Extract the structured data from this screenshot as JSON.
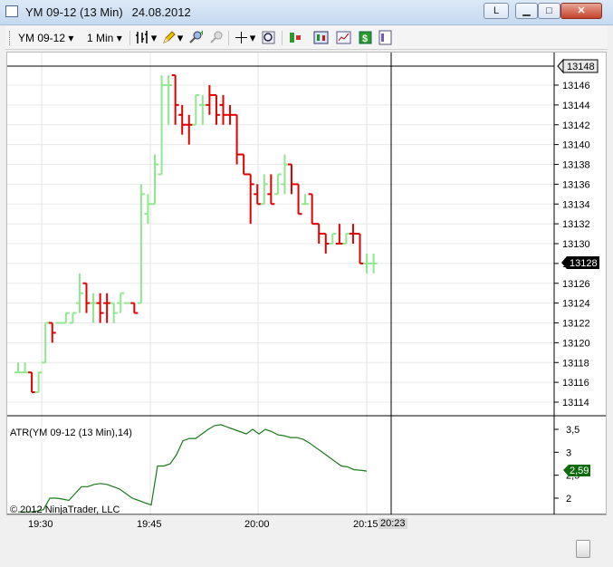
{
  "window": {
    "title": "YM 09-12 (13 Min)",
    "date": "24.08.2012",
    "buttons": {
      "user": "L",
      "minimize": "▁",
      "maximize": "□",
      "close": "✕"
    }
  },
  "toolbar": {
    "instrument": "YM 09-12",
    "interval": "1 Min",
    "icons": [
      "bar-style-icon",
      "pencil-draw-icon",
      "zoom-in-icon",
      "zoom-out-icon",
      "crosshair-icon",
      "magnify-icon",
      "strategies-icon",
      "indicators-icon",
      "chart-icon",
      "money-icon",
      "properties-icon"
    ]
  },
  "price_panel": {
    "y_ticks": [
      "13146",
      "13144",
      "13142",
      "13140",
      "13138",
      "13136",
      "13134",
      "13132",
      "13130",
      "13128",
      "13126",
      "13124",
      "13122",
      "13120",
      "13118",
      "13116",
      "13114"
    ],
    "crosshair_price": "13148",
    "last_price": "13128"
  },
  "indicator_panel": {
    "label": "ATR(YM 09-12 (13 Min),14)",
    "y_ticks": [
      "3,5",
      "3",
      "2,5",
      "2"
    ],
    "current_value": "2,59"
  },
  "time_axis": {
    "labels": [
      "19:30",
      "19:45",
      "20:00",
      "20:15"
    ],
    "crosshair_time": "20:23"
  },
  "copyright": "© 2012 NinjaTrader, LLC",
  "colors": {
    "up": "#8ee88e",
    "down": "#e00000",
    "atr": "#1a7a1a",
    "crosshair": "#000000"
  },
  "chart_data": [
    {
      "type": "ohlc",
      "bars": [
        {
          "o": 13117,
          "h": 13118,
          "l": 13117,
          "c": 13117,
          "dir": "up"
        },
        {
          "o": 13117,
          "h": 13118,
          "l": 13117,
          "c": 13117,
          "dir": "up"
        },
        {
          "o": 13117,
          "h": 13117,
          "l": 13115,
          "c": 13115,
          "dir": "down"
        },
        {
          "o": 13115,
          "h": 13117,
          "l": 13115,
          "c": 13117,
          "dir": "up"
        },
        {
          "o": 13118,
          "h": 13122,
          "l": 13118,
          "c": 13122,
          "dir": "up"
        },
        {
          "o": 13122,
          "h": 13122,
          "l": 13120,
          "c": 13121,
          "dir": "down"
        },
        {
          "o": 13122,
          "h": 13122,
          "l": 13122,
          "c": 13122,
          "dir": "up"
        },
        {
          "o": 13122,
          "h": 13123,
          "l": 13122,
          "c": 13123,
          "dir": "up"
        },
        {
          "o": 13122,
          "h": 13123,
          "l": 13122,
          "c": 13123,
          "dir": "up"
        },
        {
          "o": 13124,
          "h": 13127,
          "l": 13123,
          "c": 13125,
          "dir": "up"
        },
        {
          "o": 13126,
          "h": 13126,
          "l": 13123,
          "c": 13124,
          "dir": "down"
        },
        {
          "o": 13124,
          "h": 13125,
          "l": 13122,
          "c": 13124,
          "dir": "up"
        },
        {
          "o": 13124,
          "h": 13125,
          "l": 13122,
          "c": 13123,
          "dir": "down"
        },
        {
          "o": 13124,
          "h": 13125,
          "l": 13122,
          "c": 13124,
          "dir": "down"
        },
        {
          "o": 13124,
          "h": 13124,
          "l": 13122,
          "c": 13123,
          "dir": "up"
        },
        {
          "o": 13124,
          "h": 13125,
          "l": 13123,
          "c": 13125,
          "dir": "up"
        },
        {
          "o": 13124,
          "h": 13124,
          "l": 13124,
          "c": 13124,
          "dir": "up"
        },
        {
          "o": 13124,
          "h": 13124,
          "l": 13123,
          "c": 13123,
          "dir": "down"
        },
        {
          "o": 13124,
          "h": 13136,
          "l": 13124,
          "c": 13135,
          "dir": "up"
        },
        {
          "o": 13133,
          "h": 13135,
          "l": 13132,
          "c": 13134,
          "dir": "up"
        },
        {
          "o": 13134,
          "h": 13139,
          "l": 13134,
          "c": 13138,
          "dir": "up"
        },
        {
          "o": 13137,
          "h": 13147,
          "l": 13137,
          "c": 13146,
          "dir": "up"
        },
        {
          "o": 13146,
          "h": 13147,
          "l": 13142,
          "c": 13146,
          "dir": "up"
        },
        {
          "o": 13147,
          "h": 13147,
          "l": 13142,
          "c": 13144,
          "dir": "down"
        },
        {
          "o": 13143,
          "h": 13144,
          "l": 13141,
          "c": 13142,
          "dir": "down"
        },
        {
          "o": 13142,
          "h": 13143,
          "l": 13140,
          "c": 13142,
          "dir": "down"
        },
        {
          "o": 13142,
          "h": 13145,
          "l": 13142,
          "c": 13145,
          "dir": "up"
        },
        {
          "o": 13144,
          "h": 13145,
          "l": 13142,
          "c": 13144,
          "dir": "up"
        },
        {
          "o": 13144,
          "h": 13146,
          "l": 13143,
          "c": 13145,
          "dir": "down"
        },
        {
          "o": 13145,
          "h": 13145,
          "l": 13142,
          "c": 13143,
          "dir": "down"
        },
        {
          "o": 13144,
          "h": 13145,
          "l": 13142,
          "c": 13143,
          "dir": "down"
        },
        {
          "o": 13143,
          "h": 13144,
          "l": 13142,
          "c": 13143,
          "dir": "down"
        },
        {
          "o": 13143,
          "h": 13143,
          "l": 13138,
          "c": 13139,
          "dir": "down"
        },
        {
          "o": 13139,
          "h": 13139,
          "l": 13137,
          "c": 13137,
          "dir": "down"
        },
        {
          "o": 13137,
          "h": 13137,
          "l": 13132,
          "c": 13136,
          "dir": "down"
        },
        {
          "o": 13135,
          "h": 13136,
          "l": 13134,
          "c": 13134,
          "dir": "down"
        },
        {
          "o": 13134,
          "h": 13137,
          "l": 13134,
          "c": 13136,
          "dir": "up"
        },
        {
          "o": 13135,
          "h": 13137,
          "l": 13134,
          "c": 13134,
          "dir": "down"
        },
        {
          "o": 13135,
          "h": 13137,
          "l": 13135,
          "c": 13137,
          "dir": "up"
        },
        {
          "o": 13136,
          "h": 13139,
          "l": 13135,
          "c": 13138,
          "dir": "up"
        },
        {
          "o": 13138,
          "h": 13138,
          "l": 13135,
          "c": 13136,
          "dir": "down"
        },
        {
          "o": 13136,
          "h": 13136,
          "l": 13133,
          "c": 13133,
          "dir": "down"
        },
        {
          "o": 13134,
          "h": 13135,
          "l": 13134,
          "c": 13134,
          "dir": "up"
        },
        {
          "o": 13135,
          "h": 13135,
          "l": 13132,
          "c": 13132,
          "dir": "down"
        },
        {
          "o": 13132,
          "h": 13132,
          "l": 13130,
          "c": 13131,
          "dir": "down"
        },
        {
          "o": 13131,
          "h": 13131,
          "l": 13129,
          "c": 13130,
          "dir": "down"
        },
        {
          "o": 13130,
          "h": 13131,
          "l": 13130,
          "c": 13131,
          "dir": "up"
        },
        {
          "o": 13130,
          "h": 13132,
          "l": 13130,
          "c": 13130,
          "dir": "down"
        },
        {
          "o": 13130,
          "h": 13131,
          "l": 13130,
          "c": 13131,
          "dir": "up"
        },
        {
          "o": 13131,
          "h": 13132,
          "l": 13130,
          "c": 13131,
          "dir": "down"
        },
        {
          "o": 13131,
          "h": 13131,
          "l": 13128,
          "c": 13128,
          "dir": "down"
        },
        {
          "o": 13128,
          "h": 13129,
          "l": 13127,
          "c": 13128,
          "dir": "up"
        },
        {
          "o": 13128,
          "h": 13129,
          "l": 13127,
          "c": 13128,
          "dir": "up"
        }
      ],
      "ylim": [
        13113,
        13148
      ]
    },
    {
      "type": "line",
      "name": "ATR(YM 09-12 (13 Min),14)",
      "values": [
        1.7,
        1.7,
        1.7,
        1.72,
        1.75,
        2.0,
        2.0,
        1.98,
        1.95,
        2.1,
        2.25,
        2.25,
        2.3,
        2.32,
        2.3,
        2.25,
        2.2,
        2.1,
        2.0,
        1.95,
        1.9,
        1.85,
        2.7,
        2.7,
        2.75,
        2.95,
        3.25,
        3.3,
        3.3,
        3.4,
        3.5,
        3.58,
        3.6,
        3.55,
        3.5,
        3.45,
        3.4,
        3.5,
        3.4,
        3.5,
        3.45,
        3.38,
        3.36,
        3.32,
        3.32,
        3.28,
        3.2,
        3.1,
        3.0,
        2.9,
        2.8,
        2.7,
        2.68,
        2.62,
        2.61,
        2.59
      ],
      "ylim": [
        1.85,
        3.7
      ]
    }
  ]
}
